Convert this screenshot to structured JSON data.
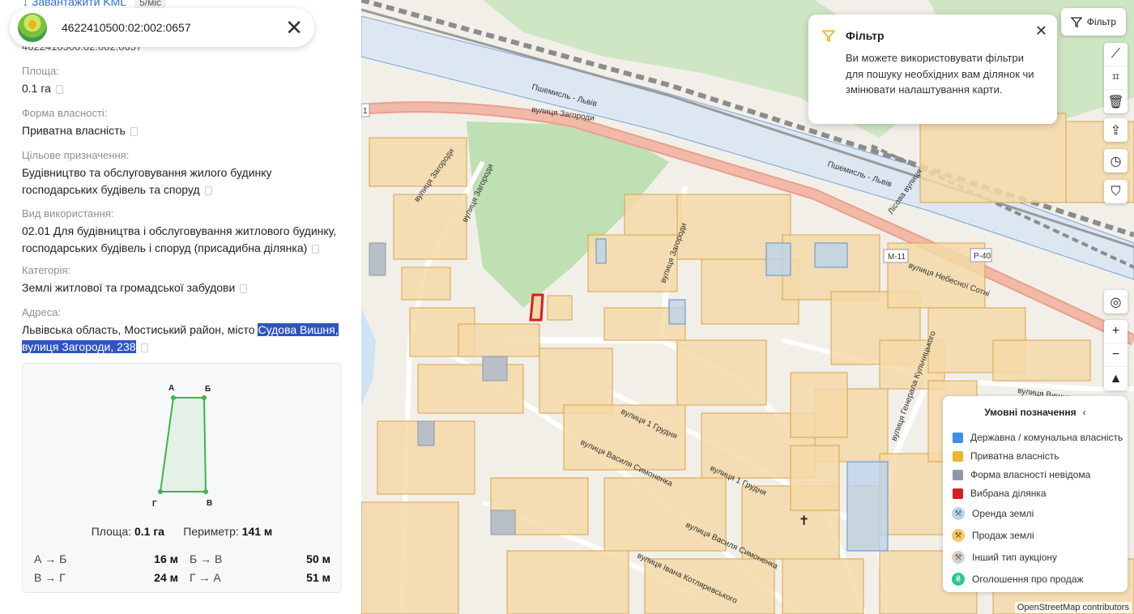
{
  "panel": {
    "download_link": "↓  Завантажити KML",
    "download_badge": "5/міс",
    "search_value": "4622410500:02:002:0657",
    "cadastral_id": "4622410500:02:002:0657",
    "fields": [
      {
        "label": "Площа:",
        "value": "0.1 га"
      },
      {
        "label": "Форма власності:",
        "value": "Приватна власність"
      },
      {
        "label": "Цільове призначення:",
        "value": "Будівництво та обслуговування жилого будинку господарських будівель та споруд"
      },
      {
        "label": "Вид використання:",
        "value": "02.01 Для будівництва і обслуговування житлового будинку, господарських будівель і споруд (присадибна ділянка)"
      },
      {
        "label": "Категорія:",
        "value": "Землі житлової та громадської забудови"
      },
      {
        "label": "Адреса:",
        "value_plain": "Львівська область, Мостиський район, місто ",
        "value_highlight": "Судова Вишня, вулиця Загороди, 238"
      }
    ],
    "plot": {
      "vertices": [
        "А",
        "Б",
        "В",
        "Г"
      ],
      "area_label": "Площа:",
      "area_value": "0.1 га",
      "perimeter_label": "Периметр:",
      "perimeter_value": "141 м",
      "sides": [
        {
          "a": "А → Б",
          "av": "16 м",
          "b": "Б → В",
          "bv": "50 м"
        },
        {
          "a": "В → Г",
          "av": "24 м",
          "b": "Г → А",
          "bv": "51 м"
        }
      ]
    }
  },
  "map": {
    "filter_button": "Фільтр",
    "tip": {
      "title": "Фільтр",
      "body": "Ви можете використовувати фільтри для пошуку необхідних вам ділянок чи змінювати налаштування карти."
    },
    "labels": {
      "street1": "вулиця Загороди",
      "street2": "вулиця Небесної Сотні",
      "street3": "вулиця Загороди",
      "street4": "вулиця Загороди",
      "street5": "вулиця Загороди",
      "street6": "вулиця 1 Грудня",
      "street7": "вулиця Василя Симоненка",
      "street8": "вулиця 1 Грудня",
      "street9": "вулиця Василя Симоненка",
      "street10": "вулиця Івана Котляревського",
      "street11": "вулиця Генерала Кульчицького",
      "street12": "вулиця Вишнева",
      "rail1": "Пшемисль - Львів",
      "rail2": "Пшемисль - Львів",
      "rail3": "Лісова вулиця",
      "road_m11": "M-11",
      "road_p40": "P-40",
      "road_1": "1"
    },
    "legend": {
      "title": "Умовні позначення",
      "items": [
        {
          "label": "Державна / комунальна власність",
          "color": "#3d8ef0"
        },
        {
          "label": "Приватна власність",
          "color": "#f0b429"
        },
        {
          "label": "Форма власності невідома",
          "color": "#8d99a6"
        },
        {
          "label": "Вибрана ділянка",
          "color": "#d21f1f"
        },
        {
          "label": "Оренда землі",
          "color": "#bcd3ea"
        },
        {
          "label": "Продаж землі",
          "color": "#f5c96a"
        },
        {
          "label": "Інший тип аукціону",
          "color": "#d9cfc7"
        },
        {
          "label": "Оголошення про продаж",
          "color": "#27c98f"
        }
      ]
    },
    "attribution": "OpenStreetMap contributors"
  }
}
